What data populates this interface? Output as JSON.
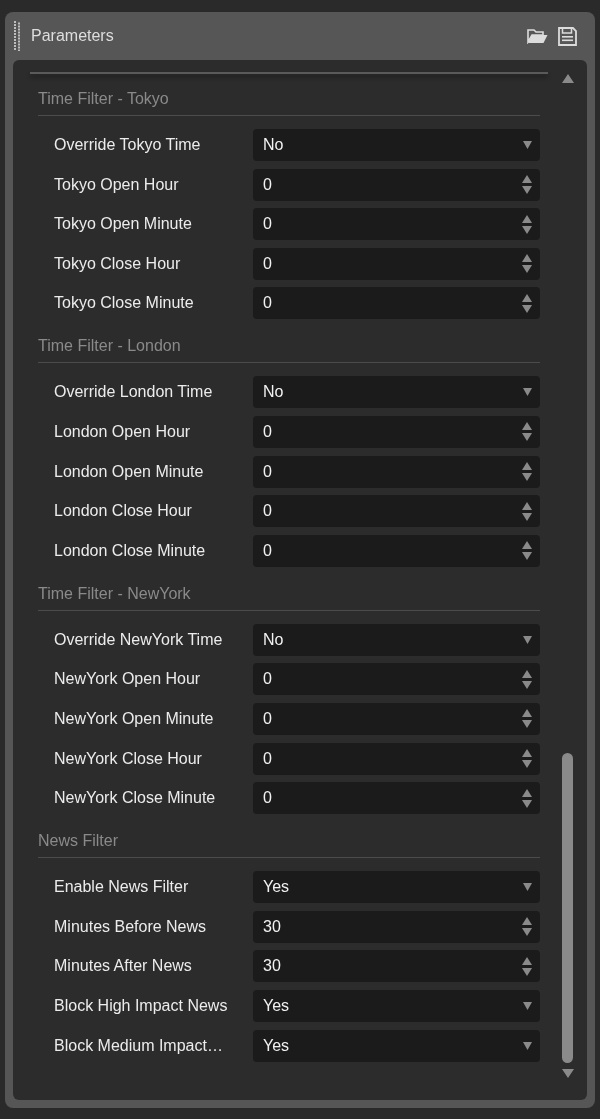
{
  "panel": {
    "title": "Parameters"
  },
  "sections": [
    {
      "title": "Time Filter - Tokyo",
      "params": [
        {
          "label": "Override Tokyo Time",
          "kind": "dropdown",
          "value": "No"
        },
        {
          "label": "Tokyo Open Hour",
          "kind": "spinner",
          "value": "0"
        },
        {
          "label": "Tokyo Open Minute",
          "kind": "spinner",
          "value": "0"
        },
        {
          "label": "Tokyo Close Hour",
          "kind": "spinner",
          "value": "0"
        },
        {
          "label": "Tokyo Close Minute",
          "kind": "spinner",
          "value": "0"
        }
      ]
    },
    {
      "title": "Time Filter - London",
      "params": [
        {
          "label": "Override London Time",
          "kind": "dropdown",
          "value": "No"
        },
        {
          "label": "London Open Hour",
          "kind": "spinner",
          "value": "0"
        },
        {
          "label": "London Open Minute",
          "kind": "spinner",
          "value": "0"
        },
        {
          "label": "London Close Hour",
          "kind": "spinner",
          "value": "0"
        },
        {
          "label": "London Close Minute",
          "kind": "spinner",
          "value": "0"
        }
      ]
    },
    {
      "title": "Time Filter - NewYork",
      "params": [
        {
          "label": "Override NewYork Time",
          "kind": "dropdown",
          "value": "No"
        },
        {
          "label": "NewYork Open Hour",
          "kind": "spinner",
          "value": "0"
        },
        {
          "label": "NewYork Open Minute",
          "kind": "spinner",
          "value": "0"
        },
        {
          "label": "NewYork Close Hour",
          "kind": "spinner",
          "value": "0"
        },
        {
          "label": "NewYork Close Minute",
          "kind": "spinner",
          "value": "0"
        }
      ]
    },
    {
      "title": "News Filter",
      "params": [
        {
          "label": "Enable News Filter",
          "kind": "dropdown",
          "value": "Yes"
        },
        {
          "label": "Minutes Before News",
          "kind": "spinner",
          "value": "30"
        },
        {
          "label": "Minutes After News",
          "kind": "spinner",
          "value": "30"
        },
        {
          "label": "Block High Impact News",
          "kind": "dropdown",
          "value": "Yes"
        },
        {
          "label": "Block Medium Impact…",
          "kind": "dropdown",
          "value": "Yes"
        }
      ]
    }
  ]
}
